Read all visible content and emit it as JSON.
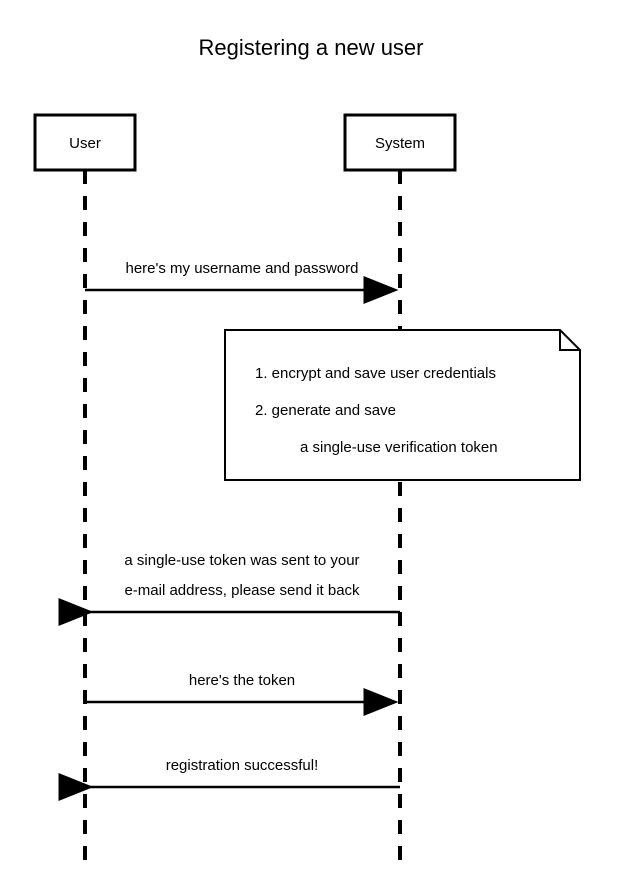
{
  "title": "Registering a new user",
  "actors": {
    "user": {
      "label": "User"
    },
    "system": {
      "label": "System"
    }
  },
  "messages": {
    "m1": "here's my username and password",
    "m2_line1": "a single-use token was sent to your",
    "m2_line2": "e-mail address, please send it back",
    "m3": "here's the token",
    "m4": "registration successful!"
  },
  "note": {
    "line1": "1. encrypt and save user credentials",
    "line2": "2. generate and save",
    "line3": "a single-use verification token"
  }
}
